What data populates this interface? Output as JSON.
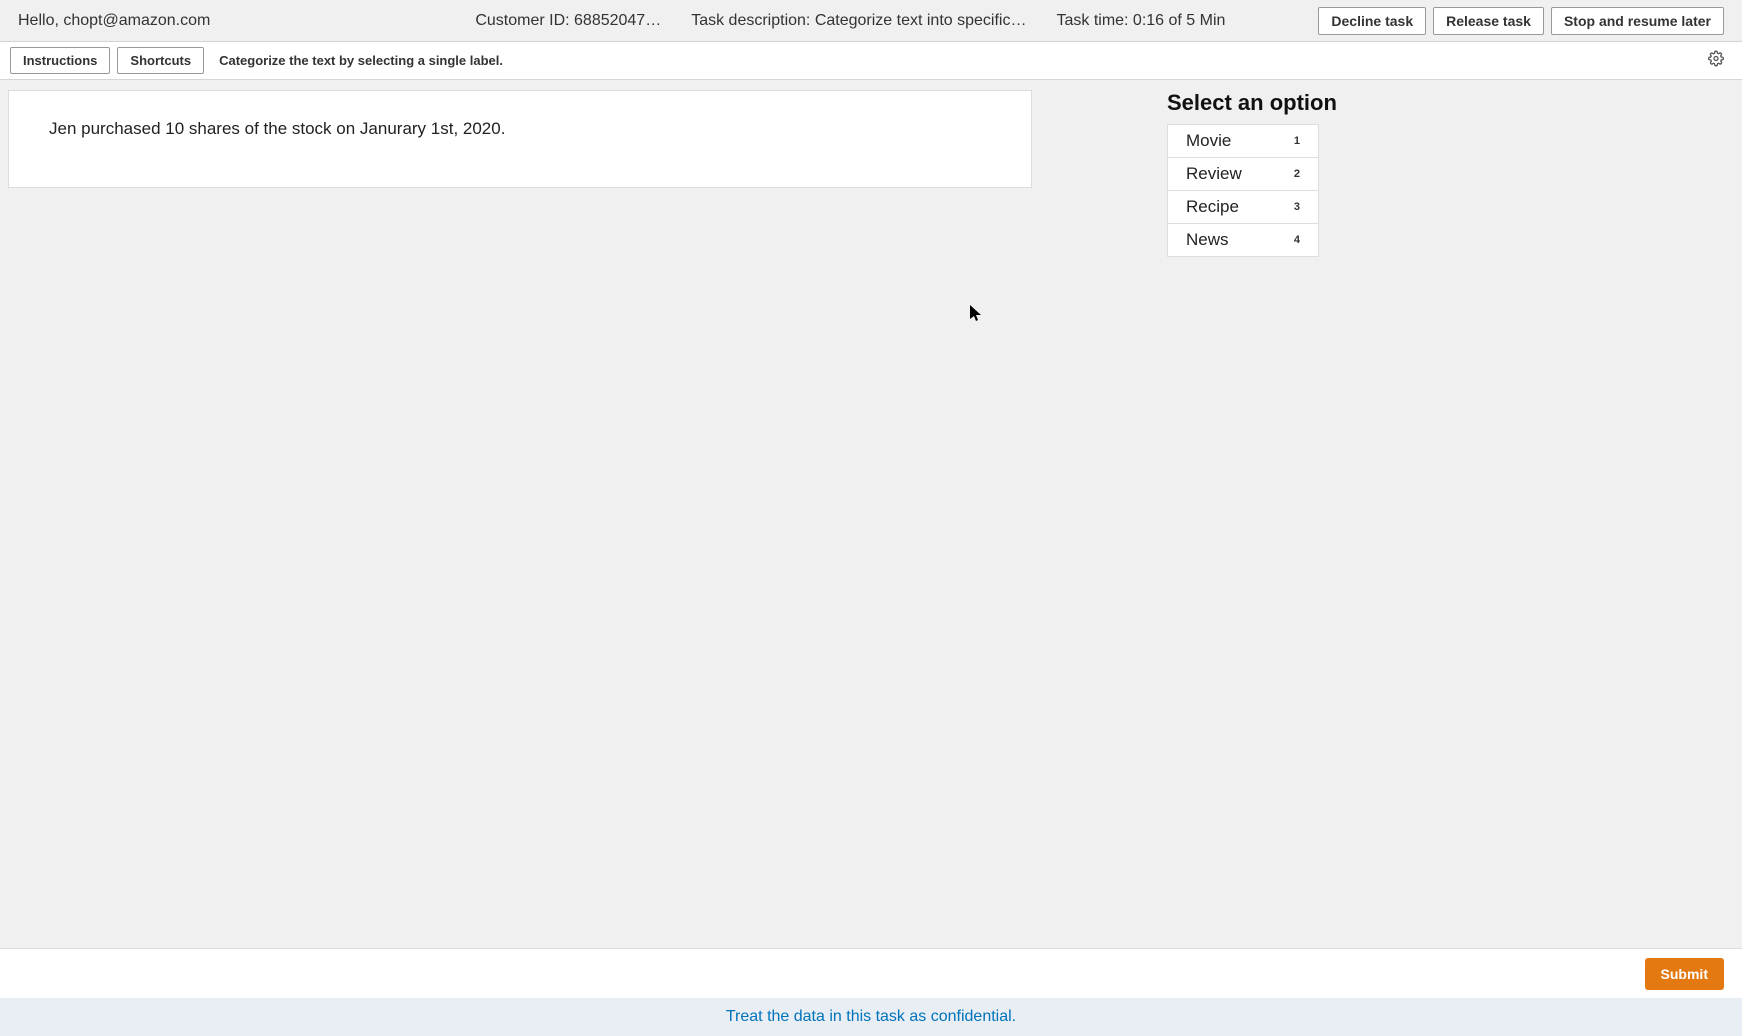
{
  "header": {
    "greeting": "Hello, chopt@amazon.com",
    "customer_id": "Customer ID: 68852047…",
    "task_description": "Task description: Categorize text into specific…",
    "task_time": "Task time: 0:16 of 5 Min",
    "buttons": {
      "decline": "Decline task",
      "release": "Release task",
      "stop": "Stop and resume later"
    }
  },
  "subheader": {
    "instructions": "Instructions",
    "shortcuts": "Shortcuts",
    "prompt": "Categorize the text by selecting a single label."
  },
  "text_content": "Jen purchased 10 shares of the stock on Janurary 1st, 2020.",
  "options": {
    "title": "Select an option",
    "items": [
      {
        "label": "Movie",
        "shortcut": "1"
      },
      {
        "label": "Review",
        "shortcut": "2"
      },
      {
        "label": "Recipe",
        "shortcut": "3"
      },
      {
        "label": "News",
        "shortcut": "4"
      }
    ]
  },
  "footer": {
    "submit": "Submit",
    "confidential": "Treat the data in this task as confidential."
  }
}
